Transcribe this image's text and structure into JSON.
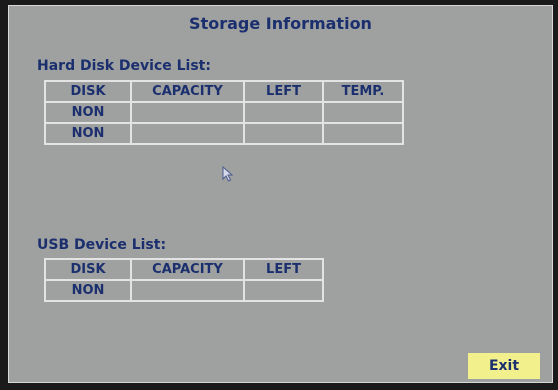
{
  "title": "Storage Information",
  "hard_disk": {
    "label": "Hard Disk Device List:",
    "headers": [
      "DISK",
      "CAPACITY",
      "LEFT",
      "TEMP."
    ],
    "rows": [
      [
        "NON",
        "",
        "",
        ""
      ],
      [
        "NON",
        "",
        "",
        ""
      ]
    ]
  },
  "usb": {
    "label": "USB Device List:",
    "headers": [
      "DISK",
      "CAPACITY",
      "LEFT"
    ],
    "rows": [
      [
        "NON",
        "",
        ""
      ]
    ]
  },
  "exit_label": "Exit",
  "colors": {
    "panel_bg": "#9fa1a0",
    "text": "#1b2f6e",
    "grid_line": "#e3e3e3",
    "exit_button_bg": "#f2f08d"
  },
  "icons": {
    "cursor": "mouse-pointer-icon"
  }
}
